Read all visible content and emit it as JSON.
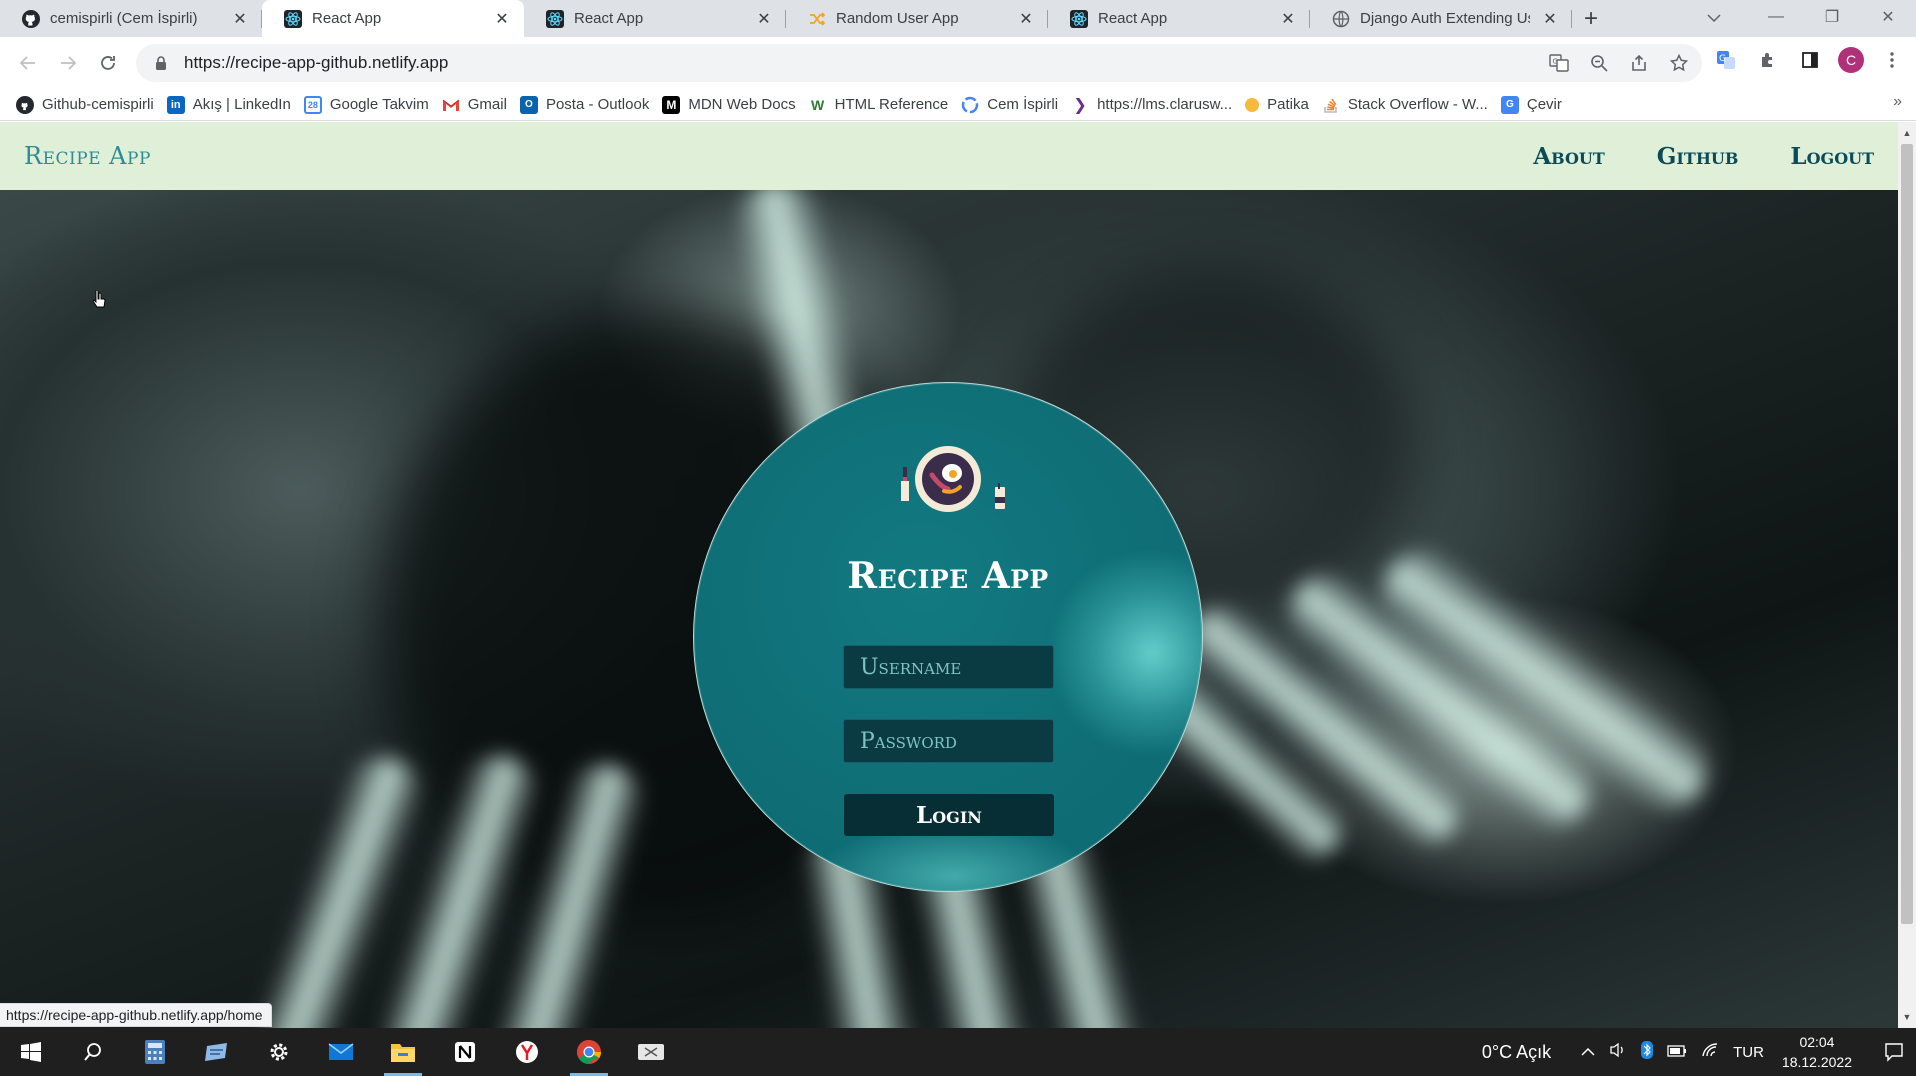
{
  "browser": {
    "tabs": [
      {
        "title": "cemispirli (Cem İspirli)",
        "icon": "github-icon",
        "active": false
      },
      {
        "title": "React App",
        "icon": "react-icon",
        "active": true
      },
      {
        "title": "React App",
        "icon": "react-icon",
        "active": false
      },
      {
        "title": "Random User App",
        "icon": "shuffle-icon",
        "active": false
      },
      {
        "title": "React App",
        "icon": "react-icon",
        "active": false
      },
      {
        "title": "Django Auth Extending Use",
        "icon": "globe-icon",
        "active": false
      }
    ],
    "url": "https://recipe-app-github.netlify.app",
    "status_url": "https://recipe-app-github.netlify.app/home",
    "profile_initial": "C",
    "bookmarks": [
      {
        "label": "Github-cemispirli",
        "icon": "github-icon",
        "color": "#24292f"
      },
      {
        "label": "Akış | LinkedIn",
        "icon": "linkedin-icon",
        "color": "#0a66c2"
      },
      {
        "label": "Google Takvim",
        "icon": "calendar-icon",
        "color": "#4285f4"
      },
      {
        "label": "Gmail",
        "icon": "gmail-icon",
        "color": "#ea4335"
      },
      {
        "label": "Posta - Outlook",
        "icon": "outlook-icon",
        "color": "#0a64ad"
      },
      {
        "label": "MDN Web Docs",
        "icon": "mdn-icon",
        "color": "#000000"
      },
      {
        "label": "HTML Reference",
        "icon": "w3-icon",
        "color": "#2e7d32"
      },
      {
        "label": "Cem İspirli",
        "icon": "google-icon",
        "color": "#4285f4"
      },
      {
        "label": "https://lms.clarusw...",
        "icon": "clarusway-icon",
        "color": "#6a2c91"
      },
      {
        "label": "Patika",
        "icon": "patika-icon",
        "color": "#f6b93b"
      },
      {
        "label": "Stack Overflow - W...",
        "icon": "stackoverflow-icon",
        "color": "#f48024"
      },
      {
        "label": "Çevir",
        "icon": "translate-icon",
        "color": "#4285f4"
      }
    ]
  },
  "site": {
    "brand": "Recipe App",
    "nav_links": [
      "About",
      "Github",
      "Logout"
    ],
    "login": {
      "title": "Recipe App",
      "username_placeholder": "Username",
      "password_placeholder": "Password",
      "button_label": "Login"
    }
  },
  "taskbar": {
    "weather": "0°C  Açık",
    "language": "TUR",
    "time": "02:04",
    "date": "18.12.2022"
  },
  "colors": {
    "nav_bg": "#e0f0d8",
    "brand": "#2e8b93",
    "circle": "#0f6e76",
    "field_bg": "#0a3b42",
    "button_bg": "#062e34"
  }
}
